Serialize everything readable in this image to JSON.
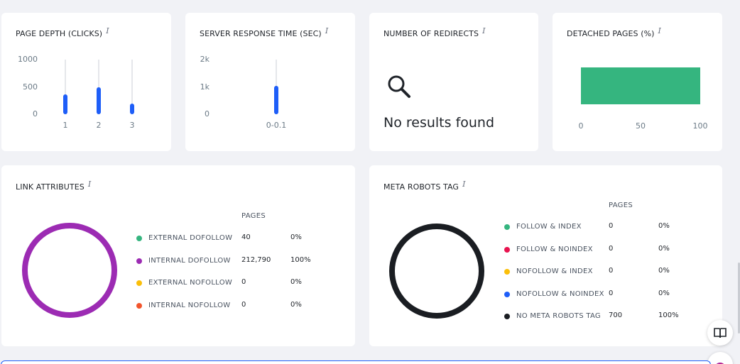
{
  "page_depth": {
    "title": "PAGE DEPTH (CLICKS)",
    "info": "i",
    "y_ticks": [
      "1000",
      "500",
      "0"
    ],
    "chart_data": {
      "type": "bar",
      "categories": [
        "1",
        "2",
        "3"
      ],
      "values": [
        370,
        490,
        200
      ],
      "ylim": [
        0,
        1000
      ]
    }
  },
  "server_response": {
    "title": "SERVER RESPONSE TIME (SEC)",
    "info": "i",
    "y_ticks": [
      "2k",
      "1k",
      "0"
    ],
    "chart_data": {
      "type": "bar",
      "categories": [
        "0-0.1"
      ],
      "values": [
        1050
      ],
      "ylim": [
        0,
        2000
      ]
    }
  },
  "redirects": {
    "title": "NUMBER OF REDIRECTS",
    "info": "i",
    "empty_text": "No results found"
  },
  "detached": {
    "title": "DETACHED PAGES (%)",
    "info": "i",
    "x_ticks": [
      "0",
      "50",
      "100"
    ],
    "chart_data": {
      "type": "bar",
      "orientation": "horizontal",
      "values": [
        100
      ],
      "xlim": [
        0,
        100
      ],
      "color": "#35b57f"
    }
  },
  "link_attributes": {
    "title": "LINK ATTRIBUTES",
    "info": "i",
    "pages_header": "PAGES",
    "rows": [
      {
        "label": "EXTERNAL DOFOLLOW",
        "pages": "40",
        "percent": "0%",
        "color": "#35b57f"
      },
      {
        "label": "INTERNAL DOFOLLOW",
        "pages": "212,790",
        "percent": "100%",
        "color": "#9c2bb3"
      },
      {
        "label": "EXTERNAL NOFOLLOW",
        "pages": "0",
        "percent": "0%",
        "color": "#fbbf09"
      },
      {
        "label": "INTERNAL NOFOLLOW",
        "pages": "0",
        "percent": "0%",
        "color": "#f2552c"
      }
    ],
    "donut_color": "#9c2bb3"
  },
  "meta_robots": {
    "title": "META ROBOTS TAG",
    "info": "i",
    "pages_header": "PAGES",
    "rows": [
      {
        "label": "FOLLOW & INDEX",
        "pages": "0",
        "percent": "0%",
        "color": "#35b57f"
      },
      {
        "label": "FOLLOW & NOINDEX",
        "pages": "0",
        "percent": "0%",
        "color": "#e8134f"
      },
      {
        "label": "NOFOLLOW & INDEX",
        "pages": "0",
        "percent": "0%",
        "color": "#fbbf09"
      },
      {
        "label": "NOFOLLOW & NOINDEX",
        "pages": "0",
        "percent": "0%",
        "color": "#1e5ef8"
      },
      {
        "label": "NO META ROBOTS TAG",
        "pages": "700",
        "percent": "100%",
        "color": "#1a1d22"
      }
    ],
    "donut_color": "#1a1d22"
  }
}
